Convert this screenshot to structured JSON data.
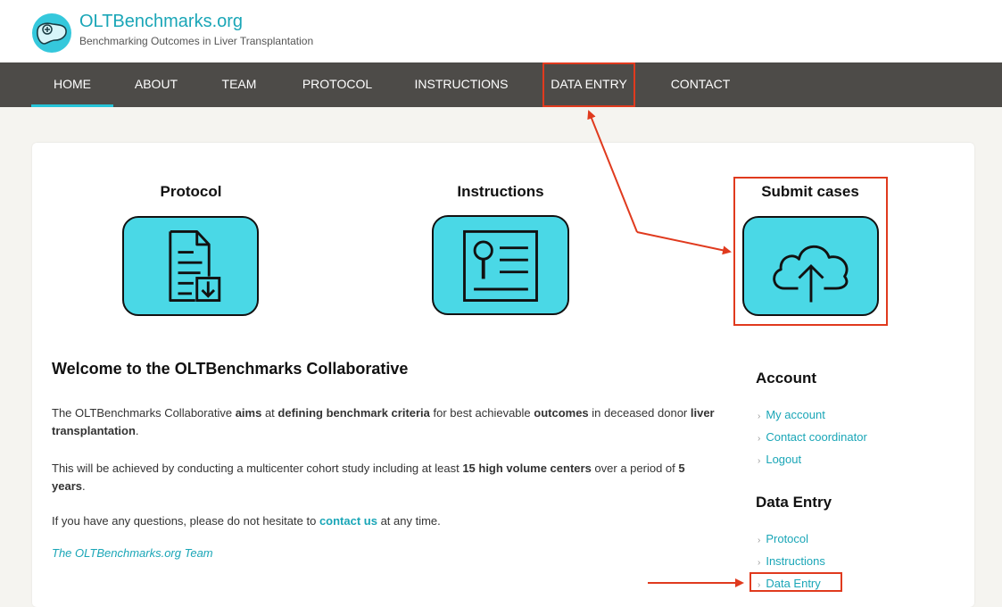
{
  "header": {
    "site_name": "OLTBenchmarks.org",
    "tagline": "Benchmarking Outcomes in Liver Transplantation"
  },
  "nav": {
    "items": [
      {
        "label": "HOME",
        "active": true
      },
      {
        "label": "ABOUT"
      },
      {
        "label": "TEAM"
      },
      {
        "label": "PROTOCOL"
      },
      {
        "label": "INSTRUCTIONS"
      },
      {
        "label": "DATA ENTRY"
      },
      {
        "label": "CONTACT"
      }
    ]
  },
  "tiles": [
    {
      "title": "Protocol",
      "icon": "document-download-icon"
    },
    {
      "title": "Instructions",
      "icon": "search-document-icon"
    },
    {
      "title": "Submit cases",
      "icon": "cloud-upload-icon"
    }
  ],
  "welcome": {
    "title": "Welcome to the OLTBenchmarks Collaborative",
    "p1": {
      "t1": "The OLTBenchmarks Collaborative ",
      "b1": "aims",
      "t2": " at ",
      "b2": "defining benchmark criteria",
      "t3": " for best achievable ",
      "b3": "outcomes",
      "t4": " in deceased donor ",
      "b4": "liver transplantation",
      "t5": "."
    },
    "p2": {
      "t1": "This will be achieved by conducting a multicenter cohort study including at least ",
      "b1": "15 high volume centers",
      "t2": " over a period of ",
      "b2": "5 years",
      "t3": "."
    },
    "p3": {
      "t1": "If you have any questions, please do not hesitate to ",
      "link": "contact us",
      "t2": " at any time."
    },
    "signature": "The OLTBenchmarks.org Team"
  },
  "sidebar": {
    "account": {
      "heading": "Account",
      "links": [
        "My account",
        "Contact coordinator",
        "Logout"
      ]
    },
    "data_entry": {
      "heading": "Data Entry",
      "links": [
        "Protocol",
        "Instructions",
        "Data Entry"
      ]
    },
    "chevron": "›"
  },
  "colors": {
    "accent": "#1aa6b7",
    "nav_bg": "#4d4b48",
    "tile_bg": "#4ad8e6",
    "annotation": "#e03a1e"
  }
}
